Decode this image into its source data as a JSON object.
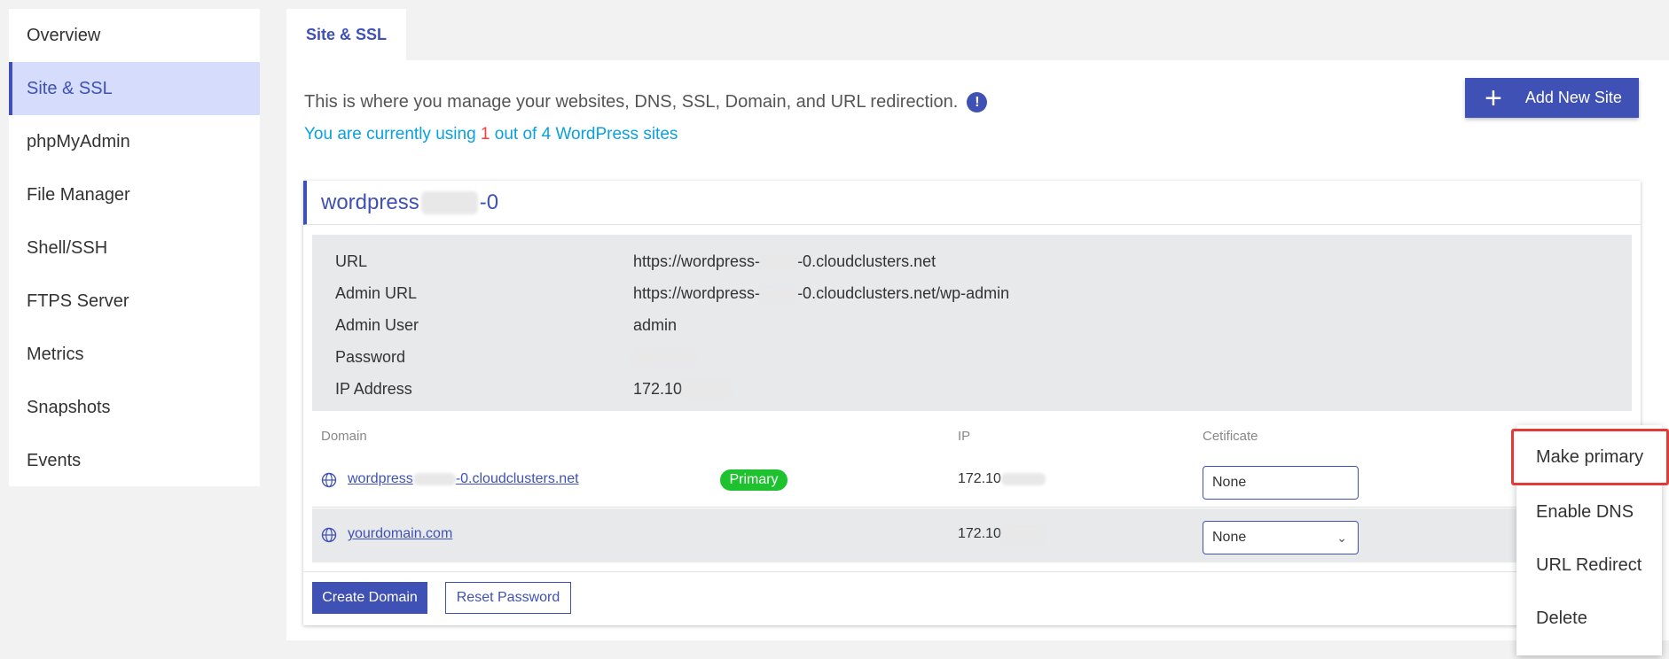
{
  "sidebar": {
    "items": [
      {
        "label": "Overview"
      },
      {
        "label": "Site & SSL"
      },
      {
        "label": "phpMyAdmin"
      },
      {
        "label": "File Manager"
      },
      {
        "label": "Shell/SSH"
      },
      {
        "label": "FTPS Server"
      },
      {
        "label": "Metrics"
      },
      {
        "label": "Snapshots"
      },
      {
        "label": "Events"
      }
    ],
    "active_index": 1
  },
  "tab": {
    "label": "Site & SSL"
  },
  "header": {
    "description": "This is where you manage your websites, DNS, SSL, Domain, and URL redirection.",
    "info_icon": "!",
    "usage_prefix": "You are currently using ",
    "usage_count": "1",
    "usage_suffix": " out of 4 WordPress sites",
    "add_button": "Add New Site",
    "add_button_icon": "+"
  },
  "site": {
    "title_prefix": "wordpress",
    "title_suffix": "-0",
    "details": [
      {
        "label": "URL",
        "value_prefix": "https://wordpress-",
        "value_suffix": "-0.cloudclusters.net"
      },
      {
        "label": "Admin URL",
        "value_prefix": "https://wordpress-",
        "value_suffix": "-0.cloudclusters.net/wp-admin"
      },
      {
        "label": "Admin User",
        "value_prefix": "admin",
        "value_suffix": ""
      },
      {
        "label": "Password",
        "value_prefix": "",
        "value_suffix": ""
      },
      {
        "label": "IP Address",
        "value_prefix": "172.10",
        "value_suffix": ""
      }
    ]
  },
  "domains": {
    "columns": {
      "domain": "Domain",
      "ip": "IP",
      "certificate": "Cetificate"
    },
    "rows": [
      {
        "domain_prefix": "wordpress",
        "domain_suffix": "-0.cloudclusters.net",
        "badge": "Primary",
        "ip": "172.10",
        "certificate": "None"
      },
      {
        "domain_prefix": "yourdomain.com",
        "domain_suffix": "",
        "badge": "",
        "ip": "172.10",
        "certificate": "None"
      }
    ]
  },
  "footer": {
    "create_domain": "Create Domain",
    "reset_password": "Reset Password"
  },
  "context_menu": {
    "items": [
      {
        "label": "Make primary"
      },
      {
        "label": "Enable DNS"
      },
      {
        "label": "URL Redirect"
      },
      {
        "label": "Delete"
      }
    ]
  },
  "colors": {
    "accent": "#3f51b5",
    "active_bg": "#d6dcfb",
    "usage_text": "#0aa1dd",
    "usage_count": "#ff3b3b",
    "primary_badge": "#1ec22e",
    "highlight_border": "#e53935"
  }
}
